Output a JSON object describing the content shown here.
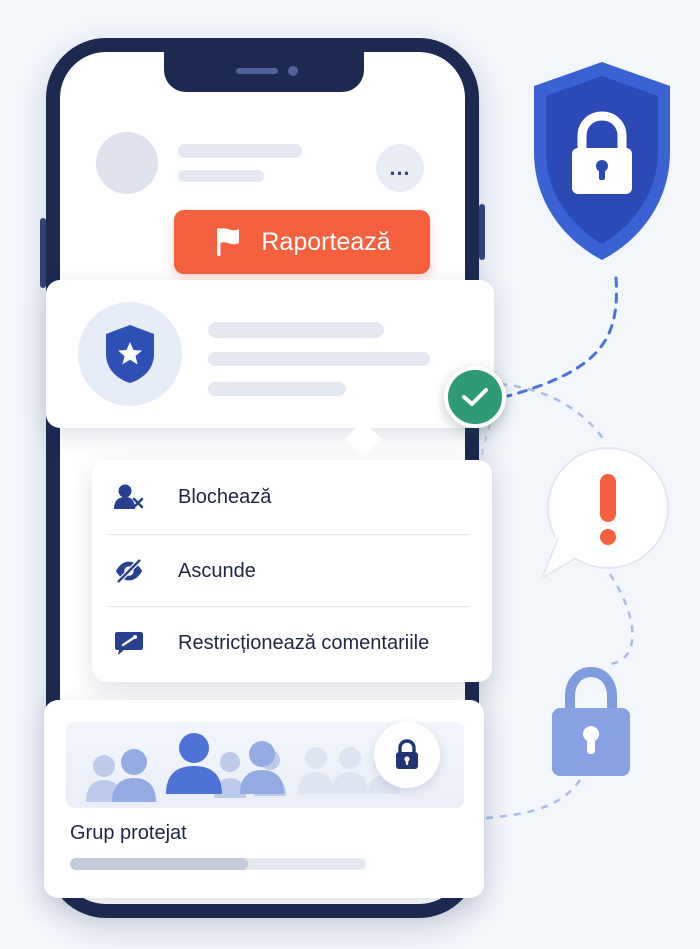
{
  "report_button": {
    "label": "Raportează",
    "color": "#f5613f"
  },
  "menu": {
    "items": [
      {
        "label": "Blochează",
        "icon": "block-user-icon"
      },
      {
        "label": "Ascunde",
        "icon": "eye-off-icon"
      },
      {
        "label": "Restricționează comentariile",
        "icon": "comment-restrict-icon"
      }
    ]
  },
  "group": {
    "title": "Grup protejat",
    "icon": "lock-icon",
    "progress": 0.6
  },
  "icons": {
    "security_card": "shield-star-icon",
    "verified": "check-circle-icon",
    "big_shield": "shield-lock-icon",
    "alert": "exclamation-bubble-icon",
    "side_lock": "padlock-icon",
    "more": "more-horizontal-icon",
    "flag": "flag-icon"
  },
  "colors": {
    "primary": "#1c2951",
    "accent_blue": "#3f63d6",
    "alert_orange": "#f5613f",
    "success_green": "#2f9a76",
    "background": "#f3f6fb"
  }
}
